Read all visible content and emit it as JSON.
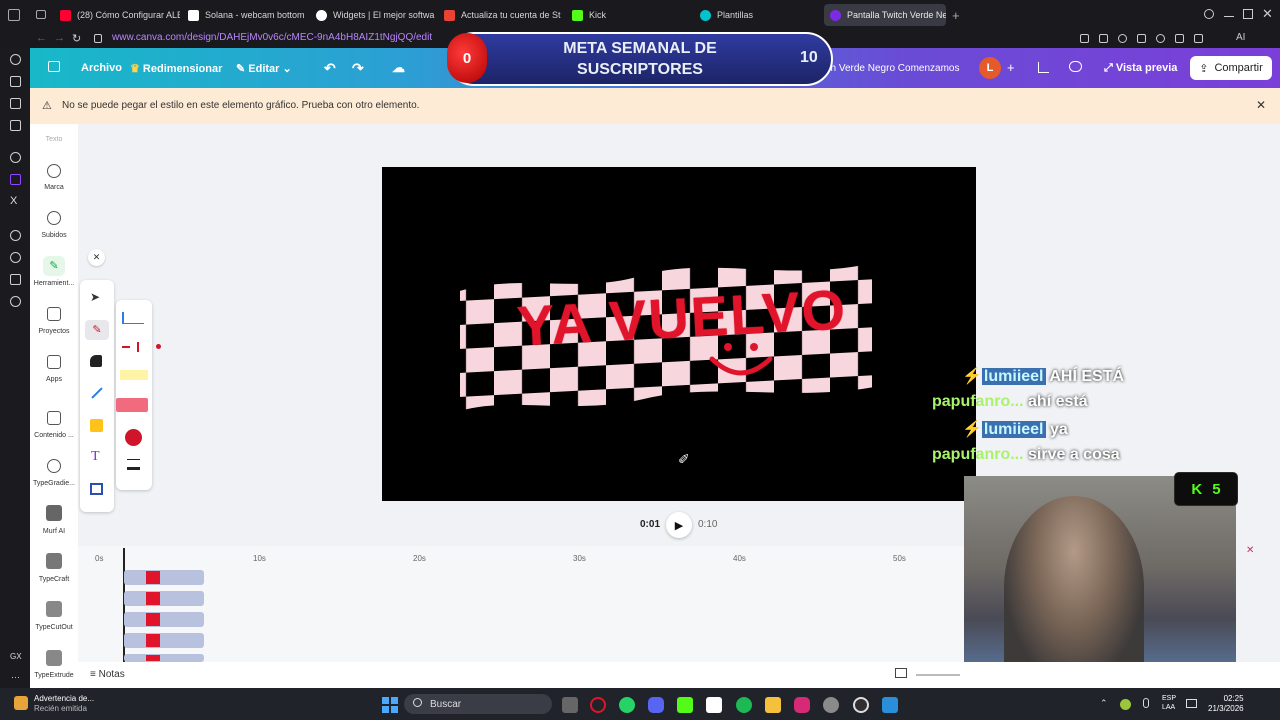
{
  "tabs": [
    {
      "label": "(28) Cómo Configurar ALE",
      "color": "#ff0033"
    },
    {
      "label": "Solana - webcam bottom",
      "color": "#ffffff"
    },
    {
      "label": "Widgets | El mejor softwa",
      "color": "#ffffff"
    },
    {
      "label": "Actualiza tu cuenta de St",
      "color": "#ea4335"
    },
    {
      "label": "Kick",
      "color": "#53fc18"
    },
    {
      "label": "Plantillas",
      "color": "#00c4cc"
    },
    {
      "label": "Pantalla Twitch Verde Neg",
      "color": "#7d2ae8"
    }
  ],
  "address": {
    "url": "www.canva.com/design/DAHEjMv0v6c/cMEC-9nA4bH8AIZ1tNgjQQ/edit"
  },
  "header": {
    "archivo": "Archivo",
    "redimensionar": "Redimensionar",
    "editar": "Editar",
    "design_title": "Pantalla Twitch Verde Negro Comenzamos",
    "avatar": "L",
    "vista_previa": "Vista previa",
    "compartir": "Compartir"
  },
  "overlay": {
    "current": "0",
    "title": "META SEMANAL DE SUSCRIPTORES",
    "goal": "10"
  },
  "warning": {
    "text": "No se puede pegar el estilo en este elemento gráfico. Prueba con otro elemento."
  },
  "sidebar": [
    {
      "label": "Texto"
    },
    {
      "label": "Marca"
    },
    {
      "label": "Subidos"
    },
    {
      "label": "Herramient..."
    },
    {
      "label": "Proyectos"
    },
    {
      "label": "Apps"
    },
    {
      "label": "Contenido ..."
    },
    {
      "label": "TypeGradie..."
    },
    {
      "label": "Murf AI"
    },
    {
      "label": "TypeCraft"
    },
    {
      "label": "TypeCutOut"
    },
    {
      "label": "TypeExtrude"
    }
  ],
  "canvas": {
    "text": "YA VUELVO",
    "bg": "#000000",
    "flag_light": "#f8d6de",
    "text_color": "#e0142a"
  },
  "chat": [
    {
      "user": "lumiieel",
      "msg": "AHÍ ESTÁ",
      "style": "mod"
    },
    {
      "user": "papufanro...",
      "msg": "ahí está",
      "style": "green"
    },
    {
      "user": "lumiieel",
      "msg": "ya",
      "style": "mod"
    },
    {
      "user": "papufanro...",
      "msg": "sirve a cosa",
      "style": "green"
    }
  ],
  "kick_count": "5",
  "player": {
    "current": "0:01",
    "total": "0:10"
  },
  "timeline": {
    "ticks": [
      "0s",
      "10s",
      "20s",
      "30s",
      "40s",
      "50s"
    ]
  },
  "bottom": {
    "notas": "Notas"
  },
  "taskbar": {
    "search": "Buscar",
    "notification_title": "Advertencia de...",
    "notification_sub": "Recién emitida",
    "lang": "ESP",
    "lang2": "LAA",
    "time": "02:25",
    "date": "21/3/2026"
  }
}
